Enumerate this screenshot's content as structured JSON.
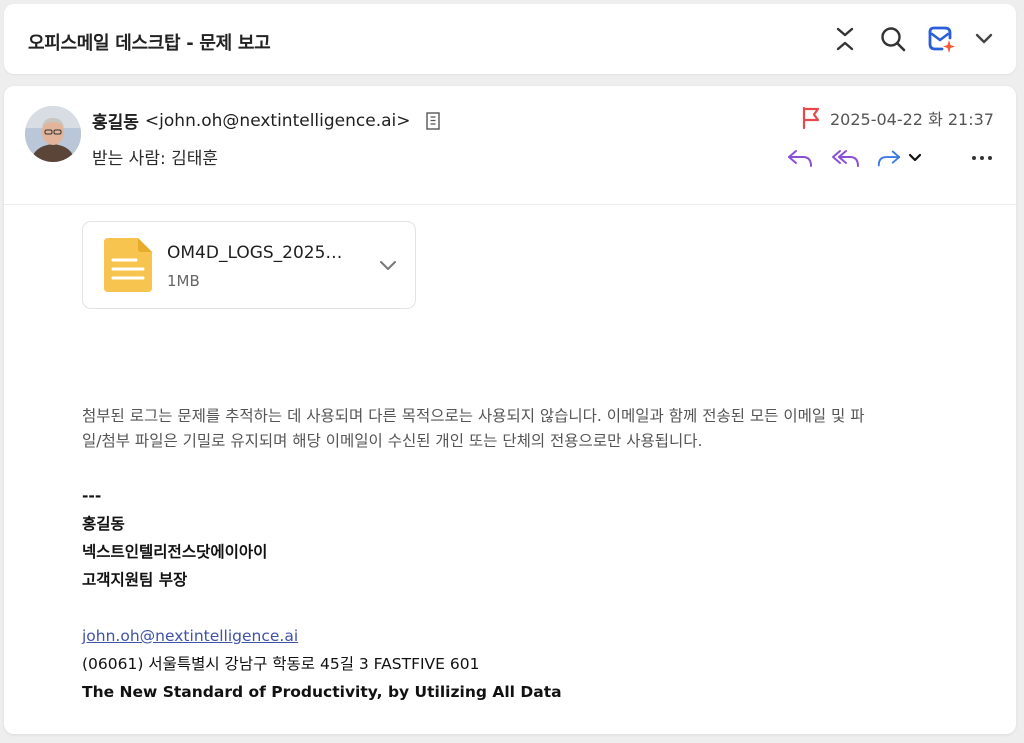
{
  "window": {
    "title": "오피스메일 데스크탑 - 문제 보고"
  },
  "toolbar": {
    "icons": [
      "collapse-icon",
      "search-icon",
      "mail-ai-icon",
      "chevron-down-icon"
    ]
  },
  "message": {
    "sender_name": "홍길동",
    "sender_email": "<john.oh@nextintelligence.ai>",
    "recipients": "받는 사람: 김태훈",
    "date": "2025-04-22 화 21:37",
    "flag_color": "#e5484d",
    "action_color_reply": "#8b4fd6",
    "action_color_forward": "#3b7be0"
  },
  "attachment": {
    "name": "OM4D_LOGS_2025…",
    "size": "1MB",
    "icon_color": "#f7c54f"
  },
  "body": {
    "paragraph_line1": "첨부된 로그는 문제를 추적하는 데 사용되며 다른 목적으로는 사용되지 않습니다. 이메일과 함께 전송된 모든 이메일 및 파",
    "paragraph_line2": "일/첨부 파일은 기밀로 유지되며 해당 이메일이 수신된 개인 또는 단체의 전용으로만 사용됩니다."
  },
  "signature": {
    "separator": "---",
    "name": "홍길동",
    "company": "넥스트인텔리전스닷에이아이",
    "title": "고객지원팀 부장",
    "email": "john.oh@nextintelligence.ai",
    "address": "(06061) 서울특별시 강남구 학동로 45길 3 FASTFIVE 601",
    "slogan": "The New Standard of Productivity, by Utilizing All Data"
  }
}
